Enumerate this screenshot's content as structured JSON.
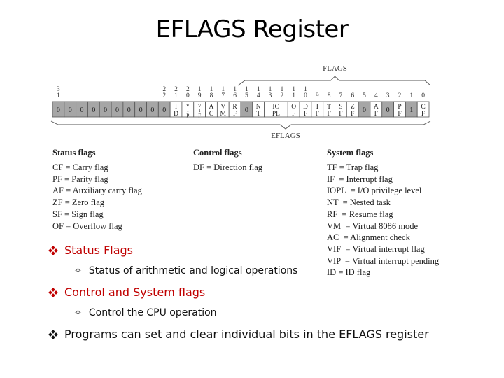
{
  "slide": {
    "title": "EFLAGS Register"
  },
  "diagram": {
    "flags_label": "FLAGS",
    "eflags_label": "EFLAGS",
    "bit_range_high": [
      "3",
      "1"
    ],
    "bits": [
      {
        "num": [
          "2",
          "1"
        ],
        "label": [
          "I",
          "D"
        ],
        "reserved": false,
        "bits": [
          21
        ]
      },
      {
        "num": [
          "2",
          "0"
        ],
        "label": [
          "V",
          "I",
          "P"
        ],
        "reserved": false,
        "bits": [
          20
        ]
      },
      {
        "num": [
          "1",
          "9"
        ],
        "label": [
          "V",
          "I",
          "F"
        ],
        "reserved": false,
        "bits": [
          19
        ]
      },
      {
        "num": [
          "1",
          "8"
        ],
        "label": [
          "A",
          "C"
        ],
        "reserved": false,
        "bits": [
          18
        ]
      },
      {
        "num": [
          "1",
          "7"
        ],
        "label": [
          "V",
          "M"
        ],
        "reserved": false,
        "bits": [
          17
        ]
      },
      {
        "num": [
          "1",
          "6"
        ],
        "label": [
          "R",
          "F"
        ],
        "reserved": false,
        "bits": [
          16
        ]
      },
      {
        "num": [
          "1",
          "5"
        ],
        "label": [
          "0"
        ],
        "reserved": true,
        "bits": [
          15
        ]
      },
      {
        "num": [
          "1",
          "4"
        ],
        "label": [
          "N",
          "T"
        ],
        "reserved": false,
        "bits": [
          14
        ]
      },
      {
        "num": [
          "1",
          "3"
        ],
        "label": [
          "IO",
          "PL"
        ],
        "reserved": false,
        "bits": [
          13,
          12
        ],
        "num2": [
          "1",
          "2"
        ]
      },
      {
        "num": [
          "1",
          "1"
        ],
        "label": [
          "O",
          "F"
        ],
        "reserved": false,
        "bits": [
          11
        ]
      },
      {
        "num": [
          "1",
          "0"
        ],
        "label": [
          "D",
          "F"
        ],
        "reserved": false,
        "bits": [
          10
        ]
      },
      {
        "num": [
          "9"
        ],
        "label": [
          "I",
          "F"
        ],
        "reserved": false,
        "bits": [
          9
        ]
      },
      {
        "num": [
          "8"
        ],
        "label": [
          "T",
          "F"
        ],
        "reserved": false,
        "bits": [
          8
        ]
      },
      {
        "num": [
          "7"
        ],
        "label": [
          "S",
          "F"
        ],
        "reserved": false,
        "bits": [
          7
        ]
      },
      {
        "num": [
          "6"
        ],
        "label": [
          "Z",
          "F"
        ],
        "reserved": false,
        "bits": [
          6
        ]
      },
      {
        "num": [
          "5"
        ],
        "label": [
          "0"
        ],
        "reserved": true,
        "bits": [
          5
        ]
      },
      {
        "num": [
          "4"
        ],
        "label": [
          "A",
          "F"
        ],
        "reserved": false,
        "bits": [
          4
        ]
      },
      {
        "num": [
          "3"
        ],
        "label": [
          "0"
        ],
        "reserved": true,
        "bits": [
          3
        ]
      },
      {
        "num": [
          "2"
        ],
        "label": [
          "P",
          "F"
        ],
        "reserved": false,
        "bits": [
          2
        ]
      },
      {
        "num": [
          "1"
        ],
        "label": [
          "1"
        ],
        "reserved": true,
        "bits": [
          1
        ]
      },
      {
        "num": [
          "0"
        ],
        "label": [
          "C",
          "F"
        ],
        "reserved": false,
        "bits": [
          0
        ]
      }
    ],
    "reserved_high_count": 10,
    "reserved_high_value": "0",
    "bit22_num": [
      "2",
      "2"
    ],
    "colors": {
      "reserved_fill": "#a6a6a6",
      "open_fill": "#ffffff",
      "border": "#555555"
    }
  },
  "flag_columns": [
    {
      "heading": "Status flags",
      "items": [
        "CF = Carry flag",
        "PF = Parity flag",
        "AF = Auxiliary carry flag",
        "ZF = Zero flag",
        "SF = Sign flag",
        "OF = Overflow flag"
      ]
    },
    {
      "heading": "Control flags",
      "items": [
        "DF = Direction flag"
      ]
    },
    {
      "heading": "System flags",
      "items": [
        "TF = Trap flag",
        "IF  = Interrupt flag",
        "IOPL  = I/O privilege level",
        "NT  = Nested task",
        "RF  = Resume flag",
        "VM  = Virtual 8086 mode",
        "AC  = Alignment check",
        "VIF  = Virtual interrupt flag",
        "VIP  = Virtual interrupt pending",
        "ID = ID flag"
      ]
    }
  ],
  "bullets": [
    {
      "level": 1,
      "text": "Status Flags",
      "color": "#c00000"
    },
    {
      "level": 2,
      "text": "Status of arithmetic and logical operations"
    },
    {
      "level": 1,
      "text": "Control and System flags",
      "color": "#c00000"
    },
    {
      "level": 2,
      "text": "Control the CPU operation"
    },
    {
      "level": 1,
      "text": "Programs can set and clear individual bits in the EFLAGS register",
      "color": "#111111"
    }
  ],
  "icons": {
    "level1_bullet": "diamond-dots-icon",
    "level2_bullet": "four-point-star-icon"
  }
}
